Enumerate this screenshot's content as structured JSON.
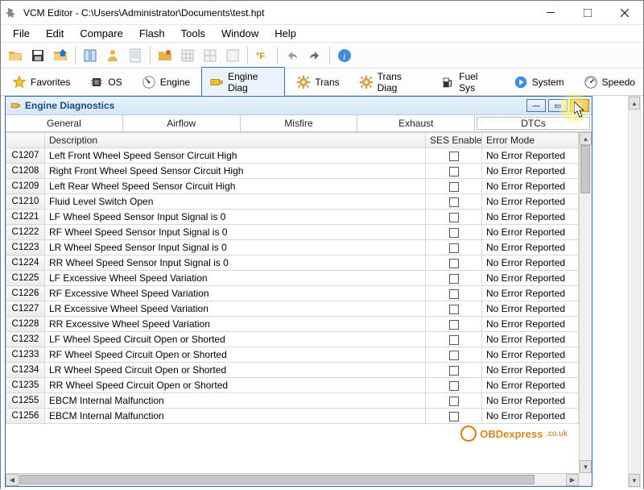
{
  "window": {
    "title": "VCM Editor - C:\\Users\\Administrator\\Documents\\test.hpt"
  },
  "menu": [
    "File",
    "Edit",
    "Compare",
    "Flash",
    "Tools",
    "Window",
    "Help"
  ],
  "cattabs": [
    {
      "label": "Favorites",
      "icon": "star"
    },
    {
      "label": "OS",
      "icon": "chip"
    },
    {
      "label": "Engine",
      "icon": "gauge"
    },
    {
      "label": "Engine Diag",
      "icon": "enginediag",
      "active": true
    },
    {
      "label": "Trans",
      "icon": "gear"
    },
    {
      "label": "Trans Diag",
      "icon": "gear"
    },
    {
      "label": "Fuel Sys",
      "icon": "pump"
    },
    {
      "label": "System",
      "icon": "media"
    },
    {
      "label": "Speedo",
      "icon": "speedo"
    }
  ],
  "child": {
    "title": "Engine Diagnostics",
    "subtabs": [
      "General",
      "Airflow",
      "Misfire",
      "Exhaust",
      "DTCs"
    ],
    "active_subtab": "DTCs",
    "columns": {
      "code": "",
      "desc": "Description",
      "ses": "SES Enable",
      "err": "Error Mode"
    },
    "rows": [
      {
        "code": "C1207",
        "desc": "Left Front Wheel Speed Sensor Circuit High",
        "err": "No Error Reported"
      },
      {
        "code": "C1208",
        "desc": "Right Front Wheel Speed Sensor Circuit High",
        "err": "No Error Reported"
      },
      {
        "code": "C1209",
        "desc": "Left Rear Wheel Speed Sensor Circuit High",
        "err": "No Error Reported"
      },
      {
        "code": "C1210",
        "desc": " Fluid Level Switch Open",
        "err": "No Error Reported"
      },
      {
        "code": "C1221",
        "desc": "LF Wheel Speed Sensor Input Signal is 0",
        "err": "No Error Reported"
      },
      {
        "code": "C1222",
        "desc": "RF Wheel Speed Sensor Input Signal is 0",
        "err": "No Error Reported"
      },
      {
        "code": "C1223",
        "desc": "LR Wheel Speed Sensor Input Signal is 0",
        "err": "No Error Reported"
      },
      {
        "code": "C1224",
        "desc": "RR Wheel Speed Sensor Input Signal is 0",
        "err": "No Error Reported"
      },
      {
        "code": "C1225",
        "desc": "LF Excessive Wheel Speed Variation",
        "err": "No Error Reported"
      },
      {
        "code": "C1226",
        "desc": "RF Excessive Wheel Speed Variation",
        "err": "No Error Reported"
      },
      {
        "code": "C1227",
        "desc": "LR Excessive Wheel Speed Variation",
        "err": "No Error Reported"
      },
      {
        "code": "C1228",
        "desc": "RR Excessive Wheel Speed Variation",
        "err": "No Error Reported"
      },
      {
        "code": "C1232",
        "desc": "LF Wheel Speed Circuit Open or Shorted",
        "err": "No Error Reported"
      },
      {
        "code": "C1233",
        "desc": "RF Wheel Speed Circuit Open or Shorted",
        "err": "No Error Reported"
      },
      {
        "code": "C1234",
        "desc": "LR Wheel Speed Circuit Open or Shorted",
        "err": "No Error Reported"
      },
      {
        "code": "C1235",
        "desc": "RR Wheel Speed Circuit Open or Shorted",
        "err": "No Error Reported"
      },
      {
        "code": "C1255",
        "desc": "EBCM Internal Malfunction",
        "err": "No Error Reported"
      },
      {
        "code": "C1256",
        "desc": "EBCM Internal Malfunction",
        "err": "No Error Reported"
      }
    ]
  },
  "watermark": {
    "text": "OBDexpress",
    "suffix": ".co.uk"
  }
}
